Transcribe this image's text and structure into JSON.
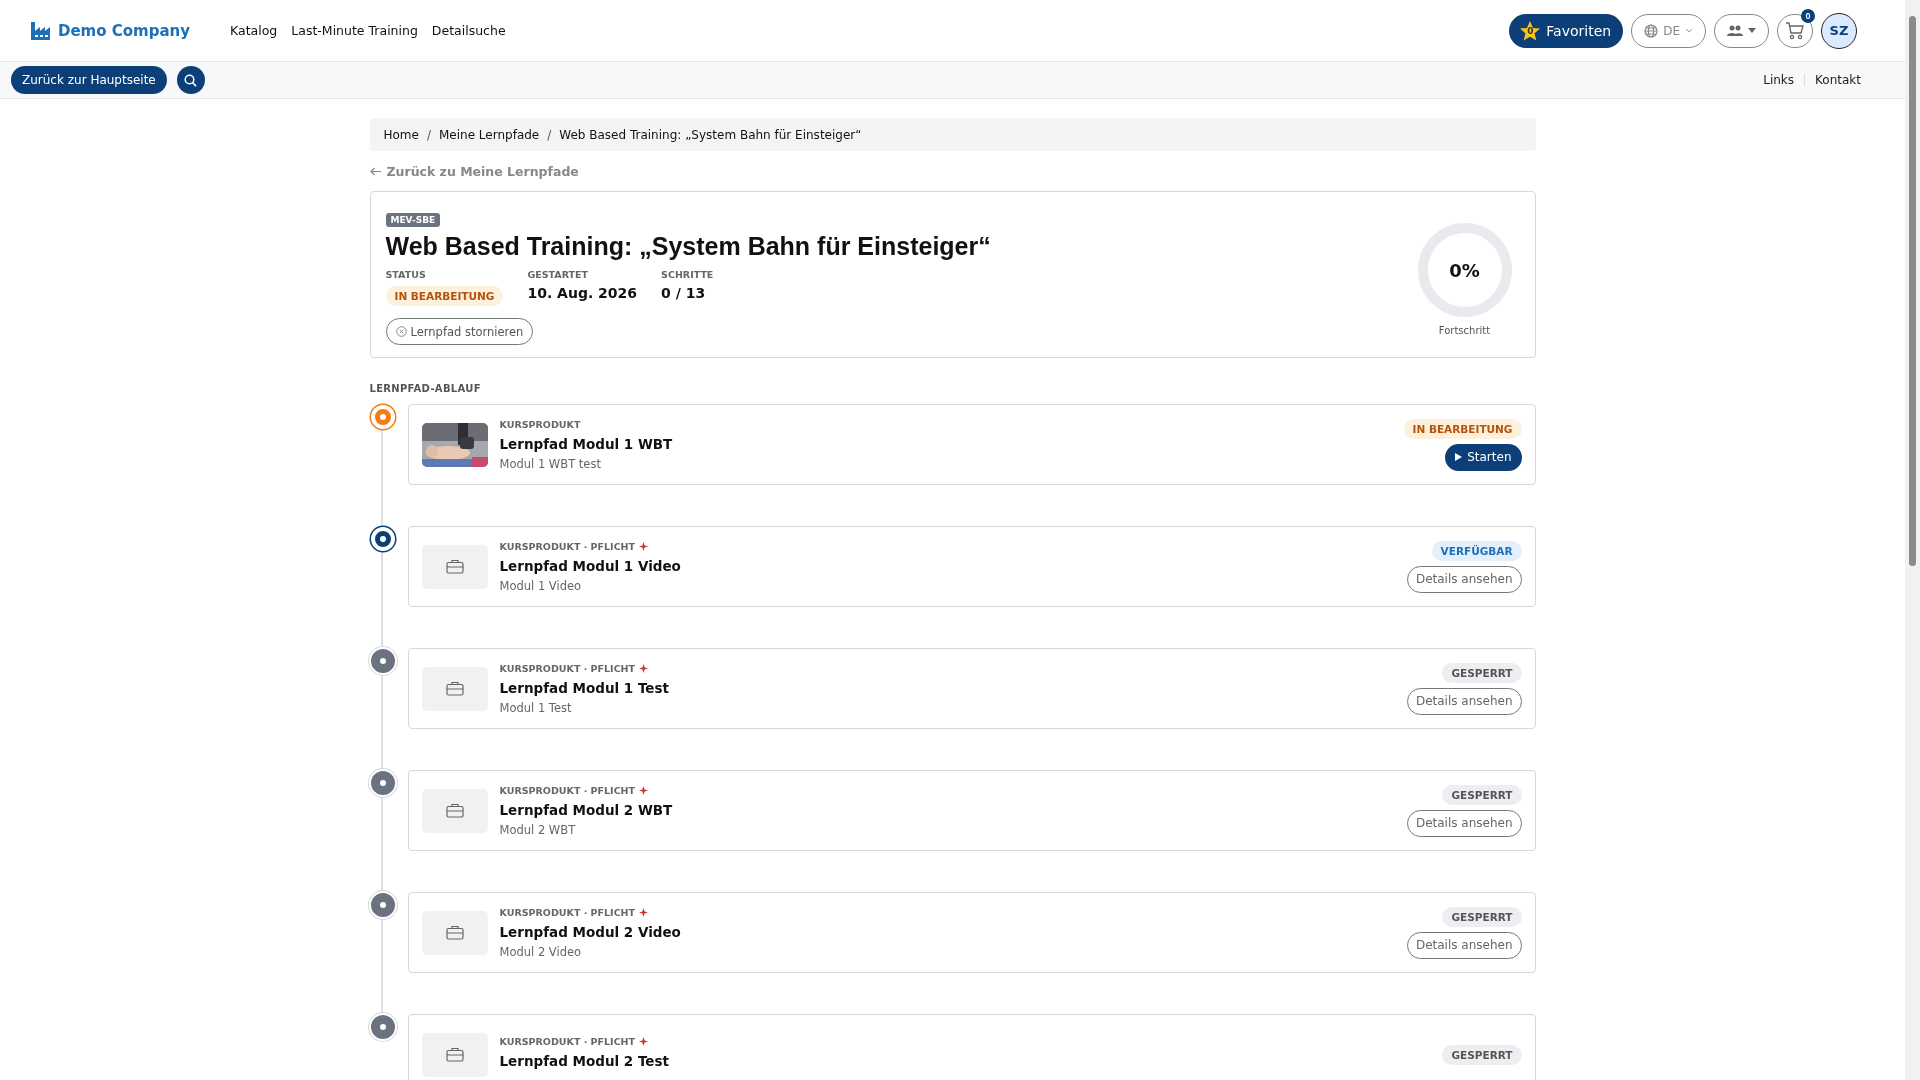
{
  "header": {
    "brand": "Demo Company",
    "nav": [
      "Katalog",
      "Last-Minute Training",
      "Detailsuche"
    ],
    "favorites": {
      "label": "Favoriten",
      "count": "0"
    },
    "language": "DE",
    "cart_count": "0",
    "avatar": "SZ"
  },
  "subbar": {
    "back_button": "Zurück zur Hauptseite",
    "links": [
      "Links",
      "Kontakt"
    ]
  },
  "breadcrumb": {
    "separator": "/",
    "items": [
      "Home",
      "Meine Lernpfade",
      "Web Based Training: „System Bahn für Einsteiger“"
    ]
  },
  "back_link": "Zurück zu Meine Lernpfade",
  "summary": {
    "code": "MEV-SBE",
    "title": "Web Based Training: „System Bahn für Einsteiger“",
    "fields": [
      {
        "label": "STATUS",
        "value": "IN BEARBEITUNG",
        "kind": "badge"
      },
      {
        "label": "GESTARTET",
        "value": "10. Aug. 2026",
        "kind": "text"
      },
      {
        "label": "SCHRITTE",
        "value": "0 / 13",
        "kind": "text"
      }
    ],
    "cancel_button": "Lernpfad stornieren",
    "progress": {
      "value": "0%",
      "caption": "Fortschritt"
    }
  },
  "section_title": "LERNPFAD-ABLAUF",
  "steps": [
    {
      "kind": "active",
      "category": "KURSPRODUKT",
      "required": false,
      "title": "Lernpfad Modul 1 WBT",
      "subtitle": "Modul 1 WBT test",
      "badge": "IN BEARBEITUNG",
      "action": {
        "kind": "start",
        "label": "Starten"
      }
    },
    {
      "kind": "available",
      "thumbnail": {
        "kind": "icon"
      },
      "category": "KURSPRODUKT · PFLICHT",
      "required": true,
      "title": "Lernpfad Modul 1 Video",
      "subtitle": "Modul 1 Video",
      "badge": "VERFÜGBAR",
      "action": {
        "kind": "details",
        "label": "Details ansehen"
      }
    },
    {
      "kind": "locked",
      "thumbnail": {
        "kind": "icon"
      },
      "category": "KURSPRODUKT · PFLICHT",
      "required": true,
      "title": "Lernpfad Modul 1 Test",
      "subtitle": "Modul 1 Test",
      "badge": "GESPERRT",
      "action": {
        "kind": "details",
        "label": "Details ansehen"
      }
    },
    {
      "kind": "locked",
      "thumbnail": {
        "kind": "icon"
      },
      "category": "KURSPRODUKT · PFLICHT",
      "required": true,
      "title": "Lernpfad Modul 2 WBT",
      "subtitle": "Modul 2 WBT",
      "badge": "GESPERRT",
      "action": {
        "kind": "details",
        "label": "Details ansehen"
      }
    },
    {
      "kind": "locked",
      "thumbnail": {
        "kind": "icon"
      },
      "category": "KURSPRODUKT · PFLICHT",
      "required": true,
      "title": "Lernpfad Modul 2 Video",
      "subtitle": "Modul 2 Video",
      "badge": "GESPERRT",
      "action": {
        "kind": "details",
        "label": "Details ansehen"
      }
    },
    {
      "kind": "locked",
      "thumbnail": {
        "kind": "icon"
      },
      "category": "KURSPRODUKT · PFLICHT",
      "required": true,
      "title": "Lernpfad Modul 2 Test",
      "badge": "GESPERRT"
    }
  ]
}
